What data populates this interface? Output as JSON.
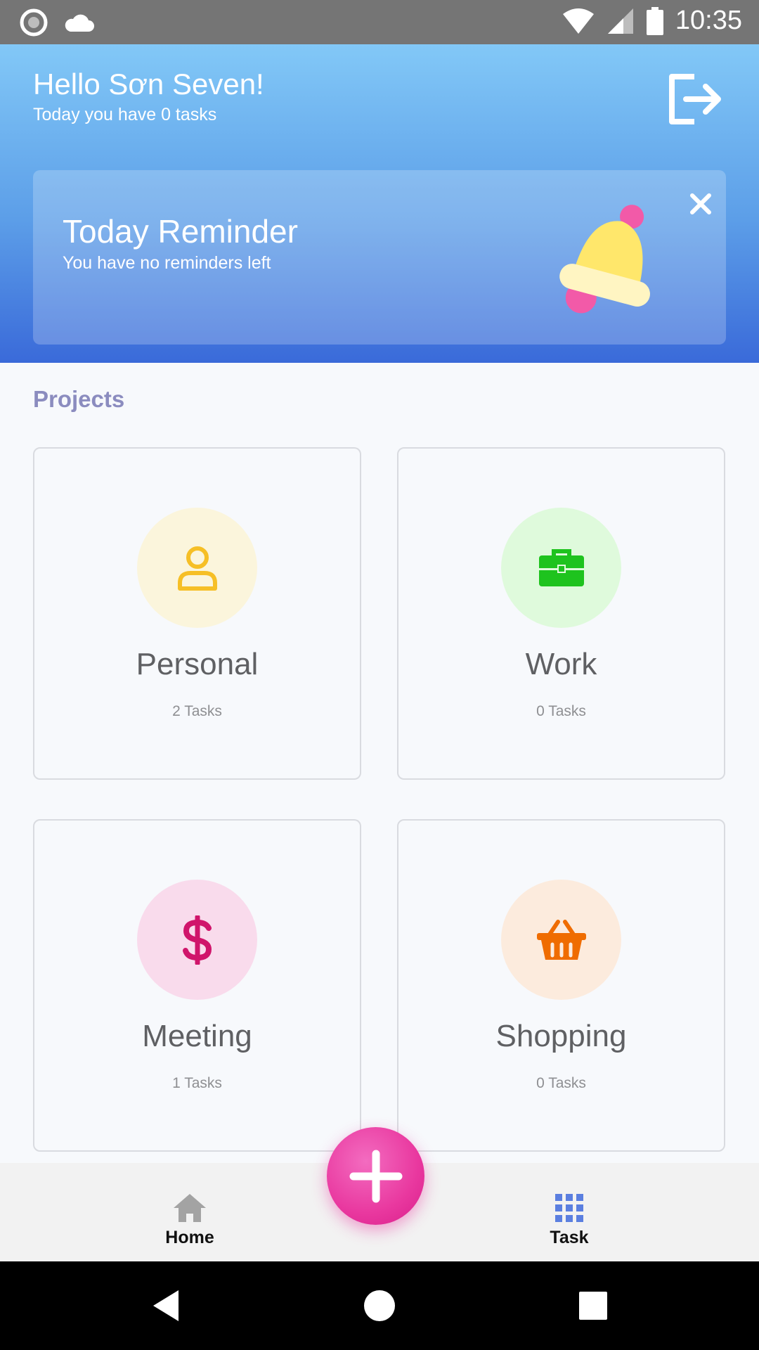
{
  "status_bar": {
    "time": "10:35"
  },
  "header": {
    "greeting": "Hello Sơn Seven!",
    "subtitle": "Today you have 0 tasks"
  },
  "reminder": {
    "title": "Today Reminder",
    "subtitle": "You have no reminders left"
  },
  "projects": {
    "label": "Projects",
    "items": [
      {
        "name": "Personal",
        "count": "2 Tasks",
        "icon": "person-icon",
        "icon_color": "#f6bf26",
        "bg_color": "#fbf5dc"
      },
      {
        "name": "Work",
        "count": "0 Tasks",
        "icon": "briefcase-icon",
        "icon_color": "#1ec31e",
        "bg_color": "#dffadc"
      },
      {
        "name": "Meeting",
        "count": "1 Tasks",
        "icon": "dollar-icon",
        "icon_color": "#d0156b",
        "bg_color": "#f9dbec"
      },
      {
        "name": "Shopping",
        "count": "0 Tasks",
        "icon": "basket-icon",
        "icon_color": "#ef6c00",
        "bg_color": "#fcebdd"
      }
    ]
  },
  "bottom_nav": {
    "home_label": "Home",
    "task_label": "Task"
  },
  "colors": {
    "header_top": "#82c8f7",
    "header_bottom": "#3a6ad9",
    "fab": "#e9389f",
    "task_icon": "#5b7fe0"
  }
}
